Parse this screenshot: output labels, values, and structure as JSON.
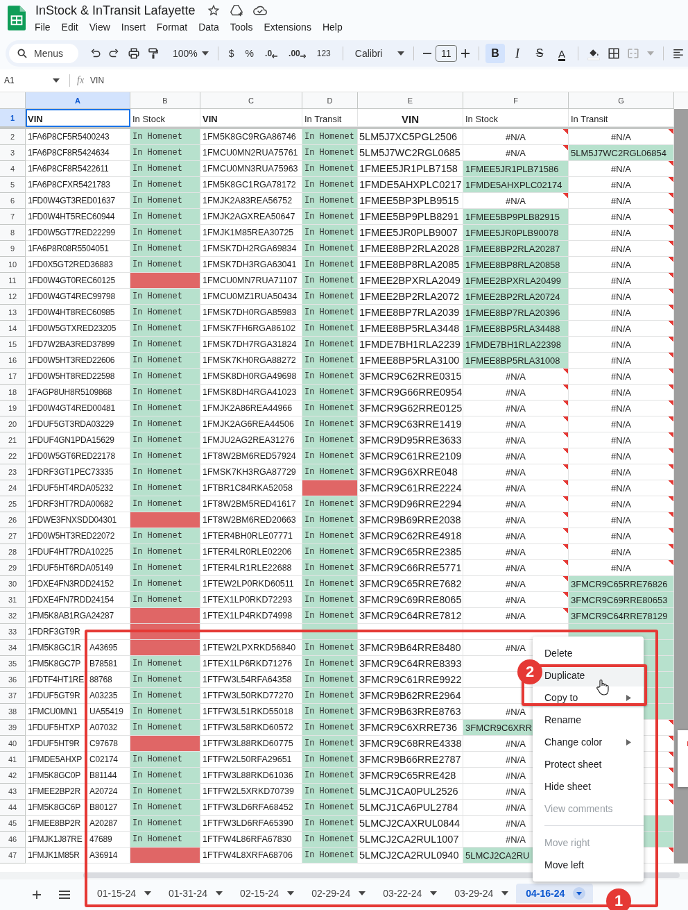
{
  "document": {
    "title": "InStock & InTransit Lafayette"
  },
  "menus": [
    "File",
    "Edit",
    "View",
    "Insert",
    "Format",
    "Data",
    "Tools",
    "Extensions",
    "Help"
  ],
  "toolbar": {
    "search_placeholder": "Menus",
    "zoom": "100%",
    "currency": "$",
    "percent": "%",
    "decrease_decimal": ".0",
    "increase_decimal": ".00",
    "number_format": "123",
    "font": "Calibri",
    "font_size": "11",
    "bold": {
      "label": "B",
      "on": true
    },
    "italic": {
      "label": "I",
      "on": false
    },
    "strikethrough": {
      "label": "S",
      "on": false
    },
    "text_color": {
      "label": "A"
    }
  },
  "formula_bar": {
    "cell": "A1",
    "icon_label": "fx",
    "value": "VIN"
  },
  "columns": [
    {
      "label": "A",
      "selected": true
    },
    {
      "label": "B",
      "selected": false
    },
    {
      "label": "C",
      "selected": false
    },
    {
      "label": "D",
      "selected": false
    },
    {
      "label": "E",
      "selected": false
    },
    {
      "label": "F",
      "selected": false
    },
    {
      "label": "G",
      "selected": false
    }
  ],
  "header_row": {
    "number": "1",
    "selected": true,
    "cells": [
      {
        "text": "VIN",
        "bold": true,
        "centered": false,
        "selected": true
      },
      {
        "text": "In Stock",
        "bold": false,
        "centered": false,
        "selected": false
      },
      {
        "text": "VIN",
        "bold": true,
        "centered": false,
        "selected": false
      },
      {
        "text": "In Transit",
        "bold": false,
        "centered": false,
        "selected": false
      },
      {
        "text": "VIN",
        "bold": true,
        "centered": true,
        "selected": false
      },
      {
        "text": "In Stock",
        "bold": false,
        "centered": false,
        "selected": false
      },
      {
        "text": "In Transit",
        "bold": false,
        "centered": false,
        "selected": false
      }
    ]
  },
  "rows": [
    {
      "number": "2",
      "cells": [
        {
          "text": "1FA6P8CF5R5400243",
          "error": false
        },
        {
          "text": "In Homenet",
          "color": "#b7e1cd",
          "error": false
        },
        {
          "text": "1FM5K8GC9RGA86746",
          "error": false
        },
        {
          "text": "In Homenet",
          "color": "#b7e1cd",
          "error": false
        },
        {
          "text": "5LM5J7XC5PGL2506",
          "error": false
        },
        {
          "text": "#N/A",
          "error": true
        },
        {
          "text": "#N/A",
          "error": true
        }
      ]
    },
    {
      "number": "3",
      "cells": [
        {
          "text": "1FA6P8CF8R5424634",
          "error": false
        },
        {
          "text": "In Homenet",
          "color": "#b7e1cd",
          "error": false
        },
        {
          "text": "1FMCU0MN2RUA75761",
          "error": false
        },
        {
          "text": "In Homenet",
          "color": "#b7e1cd",
          "error": false
        },
        {
          "text": "5LM5J7WC2RGL0685",
          "error": false
        },
        {
          "text": "#N/A",
          "error": true
        },
        {
          "text": "5LM5J7WC2RGL06854",
          "color": "#b7e1cd",
          "error": false
        }
      ]
    },
    {
      "number": "4",
      "cells": [
        {
          "text": "1FA6P8CF8R5422611",
          "error": false
        },
        {
          "text": "In Homenet",
          "color": "#b7e1cd",
          "error": false
        },
        {
          "text": "1FMCU0MN3RUA75963",
          "error": false
        },
        {
          "text": "In Homenet",
          "color": "#b7e1cd",
          "error": false
        },
        {
          "text": "1FMEE5JR1PLB7158",
          "error": false
        },
        {
          "text": "1FMEE5JR1PLB71586",
          "color": "#b7e1cd",
          "error": false
        },
        {
          "text": "#N/A",
          "error": true
        }
      ]
    },
    {
      "number": "5",
      "cells": [
        {
          "text": "1FA6P8CFXR5421783",
          "error": false
        },
        {
          "text": "In Homenet",
          "color": "#b7e1cd",
          "error": false
        },
        {
          "text": "1FM5K8GC1RGA78172",
          "error": false
        },
        {
          "text": "In Homenet",
          "color": "#b7e1cd",
          "error": false
        },
        {
          "text": "1FMDE5AHXPLC0217",
          "error": false
        },
        {
          "text": "1FMDE5AHXPLC02174",
          "color": "#b7e1cd",
          "error": false
        },
        {
          "text": "#N/A",
          "error": true
        }
      ]
    },
    {
      "number": "6",
      "cells": [
        {
          "text": "1FD0W4GT3RED01637",
          "error": false
        },
        {
          "text": "In Homenet",
          "color": "#b7e1cd",
          "error": false
        },
        {
          "text": "1FMJK2A83REA56752",
          "error": false
        },
        {
          "text": "In Homenet",
          "color": "#b7e1cd",
          "error": false
        },
        {
          "text": "1FMEE5BP3PLB9515",
          "error": false
        },
        {
          "text": "#N/A",
          "error": true
        },
        {
          "text": "#N/A",
          "error": true
        }
      ]
    },
    {
      "number": "7",
      "cells": [
        {
          "text": "1FD0W4HT5REC60944",
          "error": false
        },
        {
          "text": "In Homenet",
          "color": "#b7e1cd",
          "error": false
        },
        {
          "text": "1FMJK2AGXREA50647",
          "error": false
        },
        {
          "text": "In Homenet",
          "color": "#b7e1cd",
          "error": false
        },
        {
          "text": "1FMEE5BP9PLB8291",
          "error": false
        },
        {
          "text": "1FMEE5BP9PLB82915",
          "color": "#b7e1cd",
          "error": false
        },
        {
          "text": "#N/A",
          "error": true
        }
      ]
    },
    {
      "number": "8",
      "cells": [
        {
          "text": "1FD0W5GT7RED22299",
          "error": false
        },
        {
          "text": "In Homenet",
          "color": "#b7e1cd",
          "error": false
        },
        {
          "text": "1FMJK1M85REA30725",
          "error": false
        },
        {
          "text": "In Homenet",
          "color": "#b7e1cd",
          "error": false
        },
        {
          "text": "1FMEE5JR0PLB9007",
          "error": false
        },
        {
          "text": "1FMEE5JR0PLB90078",
          "color": "#b7e1cd",
          "error": false
        },
        {
          "text": "#N/A",
          "error": true
        }
      ]
    },
    {
      "number": "9",
      "cells": [
        {
          "text": "1FA6P8R08R5504051",
          "error": false
        },
        {
          "text": "In Homenet",
          "color": "#b7e1cd",
          "error": false
        },
        {
          "text": "1FMSK7DH2RGA69834",
          "error": false
        },
        {
          "text": "In Homenet",
          "color": "#b7e1cd",
          "error": false
        },
        {
          "text": "1FMEE8BP2RLA2028",
          "error": false
        },
        {
          "text": "1FMEE8BP2RLA20287",
          "color": "#b7e1cd",
          "error": false
        },
        {
          "text": "#N/A",
          "error": true
        }
      ]
    },
    {
      "number": "10",
      "cells": [
        {
          "text": "1FD0X5GT2RED36883",
          "error": false
        },
        {
          "text": "In Homenet",
          "color": "#b7e1cd",
          "error": false
        },
        {
          "text": "1FMSK7DH3RGA63041",
          "error": false
        },
        {
          "text": "In Homenet",
          "color": "#b7e1cd",
          "error": false
        },
        {
          "text": "1FMEE8BP8RLA2085",
          "error": false
        },
        {
          "text": "1FMEE8BP8RLA20858",
          "color": "#b7e1cd",
          "error": false
        },
        {
          "text": "#N/A",
          "error": true
        }
      ]
    },
    {
      "number": "11",
      "cells": [
        {
          "text": "1FD0W4GT0REC60125",
          "error": false
        },
        {
          "color": "#e06666",
          "error": false
        },
        {
          "text": "1FMCU0MN7RUA71107",
          "error": false
        },
        {
          "text": "In Homenet",
          "color": "#b7e1cd",
          "error": false
        },
        {
          "text": "1FMEE2BPXRLA2049",
          "error": false
        },
        {
          "text": "1FMEE2BPXRLA20499",
          "color": "#b7e1cd",
          "error": false
        },
        {
          "text": "#N/A",
          "error": true
        }
      ]
    },
    {
      "number": "12",
      "cells": [
        {
          "text": "1FD0W4GT4REC99798",
          "error": false
        },
        {
          "text": "In Homenet",
          "color": "#b7e1cd",
          "error": false
        },
        {
          "text": "1FMCU0MZ1RUA50434",
          "error": false
        },
        {
          "text": "In Homenet",
          "color": "#b7e1cd",
          "error": false
        },
        {
          "text": "1FMEE2BP2RLA2072",
          "error": false
        },
        {
          "text": "1FMEE2BP2RLA20724",
          "color": "#b7e1cd",
          "error": false
        },
        {
          "text": "#N/A",
          "error": true
        }
      ]
    },
    {
      "number": "13",
      "cells": [
        {
          "text": "1FD0W4HT8REC60985",
          "error": false
        },
        {
          "text": "In Homenet",
          "color": "#b7e1cd",
          "error": false
        },
        {
          "text": "1FMSK7DH0RGA85983",
          "error": false
        },
        {
          "text": "In Homenet",
          "color": "#b7e1cd",
          "error": false
        },
        {
          "text": "1FMEE8BP7RLA2039",
          "error": false
        },
        {
          "text": "1FMEE8BP7RLA20396",
          "color": "#b7e1cd",
          "error": false
        },
        {
          "text": "#N/A",
          "error": true
        }
      ]
    },
    {
      "number": "14",
      "cells": [
        {
          "text": "1FD0W5GTXRED23205",
          "error": false
        },
        {
          "text": "In Homenet",
          "color": "#b7e1cd",
          "error": false
        },
        {
          "text": "1FMSK7FH6RGA86102",
          "error": false
        },
        {
          "text": "In Homenet",
          "color": "#b7e1cd",
          "error": false
        },
        {
          "text": "1FMEE8BP5RLA3448",
          "error": false
        },
        {
          "text": "1FMEE8BP5RLA34488",
          "color": "#b7e1cd",
          "error": false
        },
        {
          "text": "#N/A",
          "error": true
        }
      ]
    },
    {
      "number": "15",
      "cells": [
        {
          "text": "1FD7W2BA3RED37899",
          "error": false
        },
        {
          "text": "In Homenet",
          "color": "#b7e1cd",
          "error": false
        },
        {
          "text": "1FMSK7DH7RGA31824",
          "error": false
        },
        {
          "text": "In Homenet",
          "color": "#b7e1cd",
          "error": false
        },
        {
          "text": "1FMDE7BH1RLA2239",
          "error": false
        },
        {
          "text": "1FMDE7BH1RLA22398",
          "color": "#b7e1cd",
          "error": false
        },
        {
          "text": "#N/A",
          "error": true
        }
      ]
    },
    {
      "number": "16",
      "cells": [
        {
          "text": "1FD0W5HT3RED22606",
          "error": false
        },
        {
          "text": "In Homenet",
          "color": "#b7e1cd",
          "error": false
        },
        {
          "text": "1FMSK7KH0RGA88272",
          "error": false
        },
        {
          "text": "In Homenet",
          "color": "#b7e1cd",
          "error": false
        },
        {
          "text": "1FMEE8BP5RLA3100",
          "error": false
        },
        {
          "text": "1FMEE8BP5RLA31008",
          "color": "#b7e1cd",
          "error": false
        },
        {
          "text": "#N/A",
          "error": true
        }
      ]
    },
    {
      "number": "17",
      "cells": [
        {
          "text": "1FD0W5HT8RED22598",
          "error": false
        },
        {
          "text": "In Homenet",
          "color": "#b7e1cd",
          "error": false
        },
        {
          "text": "1FMSK8DH0RGA49698",
          "error": false
        },
        {
          "text": "In Homenet",
          "color": "#b7e1cd",
          "error": false
        },
        {
          "text": "3FMCR9C62RRE0315",
          "error": false
        },
        {
          "text": "#N/A",
          "error": true
        },
        {
          "text": "#N/A",
          "error": true
        }
      ]
    },
    {
      "number": "18",
      "cells": [
        {
          "text": "1FAGP8UH8R5109868",
          "error": false
        },
        {
          "text": "In Homenet",
          "color": "#b7e1cd",
          "error": false
        },
        {
          "text": "1FMSK8DH4RGA41023",
          "error": false
        },
        {
          "text": "In Homenet",
          "color": "#b7e1cd",
          "error": false
        },
        {
          "text": "3FMCR9G66RRE0954",
          "error": false
        },
        {
          "text": "#N/A",
          "error": true
        },
        {
          "text": "#N/A",
          "error": true
        }
      ]
    },
    {
      "number": "19",
      "cells": [
        {
          "text": "1FD0W4GT4RED00481",
          "error": false
        },
        {
          "text": "In Homenet",
          "color": "#b7e1cd",
          "error": false
        },
        {
          "text": "1FMJK2A86REA44966",
          "error": false
        },
        {
          "text": "In Homenet",
          "color": "#b7e1cd",
          "error": false
        },
        {
          "text": "3FMCR9G62RRE0125",
          "error": false
        },
        {
          "text": "#N/A",
          "error": true
        },
        {
          "text": "#N/A",
          "error": true
        }
      ]
    },
    {
      "number": "20",
      "cells": [
        {
          "text": "1FDUF5GT3RDA03229",
          "error": false
        },
        {
          "text": "In Homenet",
          "color": "#b7e1cd",
          "error": false
        },
        {
          "text": "1FMJK2AG6REA44506",
          "error": false
        },
        {
          "text": "In Homenet",
          "color": "#b7e1cd",
          "error": false
        },
        {
          "text": "3FMCR9C63RRE1419",
          "error": false
        },
        {
          "text": "#N/A",
          "error": true
        },
        {
          "text": "#N/A",
          "error": true
        }
      ]
    },
    {
      "number": "21",
      "cells": [
        {
          "text": "1FDUF4GN1PDA15629",
          "error": false
        },
        {
          "text": "In Homenet",
          "color": "#b7e1cd",
          "error": false
        },
        {
          "text": "1FMJU2AG2REA31276",
          "error": false
        },
        {
          "text": "In Homenet",
          "color": "#b7e1cd",
          "error": false
        },
        {
          "text": "3FMCR9D95RRE3633",
          "error": false
        },
        {
          "text": "#N/A",
          "error": true
        },
        {
          "text": "#N/A",
          "error": true
        }
      ]
    },
    {
      "number": "22",
      "cells": [
        {
          "text": "1FD0W5GT6RED22178",
          "error": false
        },
        {
          "text": "In Homenet",
          "color": "#b7e1cd",
          "error": false
        },
        {
          "text": "1FT8W2BM6RED57924",
          "error": false
        },
        {
          "text": "In Homenet",
          "color": "#b7e1cd",
          "error": false
        },
        {
          "text": "3FMCR9C61RRE2109",
          "error": false
        },
        {
          "text": "#N/A",
          "error": true
        },
        {
          "text": "#N/A",
          "error": true
        }
      ]
    },
    {
      "number": "23",
      "cells": [
        {
          "text": "1FDRF3GT1PEC73335",
          "error": false
        },
        {
          "text": "In Homenet",
          "color": "#b7e1cd",
          "error": false
        },
        {
          "text": "1FMSK7KH3RGA87729",
          "error": false
        },
        {
          "text": "In Homenet",
          "color": "#b7e1cd",
          "error": false
        },
        {
          "text": "3FMCR9G6XRRE048",
          "error": false
        },
        {
          "text": "#N/A",
          "error": true
        },
        {
          "text": "#N/A",
          "error": true
        }
      ]
    },
    {
      "number": "24",
      "cells": [
        {
          "text": "1FDUF5HT4RDA05232",
          "error": false
        },
        {
          "text": "In Homenet",
          "color": "#b7e1cd",
          "error": false
        },
        {
          "text": "1FTBR1C84RKA52058",
          "error": false
        },
        {
          "color": "#e06666",
          "error": false
        },
        {
          "text": "3FMCR9C61RRE2224",
          "error": false
        },
        {
          "text": "#N/A",
          "error": true
        },
        {
          "text": "#N/A",
          "error": true
        }
      ]
    },
    {
      "number": "25",
      "cells": [
        {
          "text": "1FDRF3HT7RDA00682",
          "error": false
        },
        {
          "text": "In Homenet",
          "color": "#b7e1cd",
          "error": false
        },
        {
          "text": "1FT8W2BM5RED41617",
          "error": false
        },
        {
          "text": "In Homenet",
          "color": "#b7e1cd",
          "error": false
        },
        {
          "text": "3FMCR9D96RRE2294",
          "error": false
        },
        {
          "text": "#N/A",
          "error": true
        },
        {
          "text": "#N/A",
          "error": true
        }
      ]
    },
    {
      "number": "26",
      "cells": [
        {
          "text": "1FDWE3FNXSDD04301",
          "error": false
        },
        {
          "color": "#e06666",
          "error": false
        },
        {
          "text": "1FT8W2BM6RED20663",
          "error": false
        },
        {
          "text": "In Homenet",
          "color": "#b7e1cd",
          "error": false
        },
        {
          "text": "3FMCR9B69RRE2038",
          "error": false
        },
        {
          "text": "#N/A",
          "error": true
        },
        {
          "text": "#N/A",
          "error": true
        }
      ]
    },
    {
      "number": "27",
      "cells": [
        {
          "text": "1FD0W5HT3RED22072",
          "error": false
        },
        {
          "text": "In Homenet",
          "color": "#b7e1cd",
          "error": false
        },
        {
          "text": "1FTER4BH0RLE07771",
          "error": false
        },
        {
          "text": "In Homenet",
          "color": "#b7e1cd",
          "error": false
        },
        {
          "text": "3FMCR9C62RRE4918",
          "error": false
        },
        {
          "text": "#N/A",
          "error": true
        },
        {
          "text": "#N/A",
          "error": true
        }
      ]
    },
    {
      "number": "28",
      "cells": [
        {
          "text": "1FDUF4HT7RDA10225",
          "error": false
        },
        {
          "text": "In Homenet",
          "color": "#b7e1cd",
          "error": false
        },
        {
          "text": "1FTER4LR0RLE02206",
          "error": false
        },
        {
          "text": "In Homenet",
          "color": "#b7e1cd",
          "error": false
        },
        {
          "text": "3FMCR9C65RRE2385",
          "error": false
        },
        {
          "text": "#N/A",
          "error": true
        },
        {
          "text": "#N/A",
          "error": true
        }
      ]
    },
    {
      "number": "29",
      "cells": [
        {
          "text": "1FDUF5HT6RDA05149",
          "error": false
        },
        {
          "text": "In Homenet",
          "color": "#b7e1cd",
          "error": false
        },
        {
          "text": "1FTER4LR1RLE22688",
          "error": false
        },
        {
          "text": "In Homenet",
          "color": "#b7e1cd",
          "error": false
        },
        {
          "text": "3FMCR9C66RRE5771",
          "error": false
        },
        {
          "text": "#N/A",
          "error": true
        },
        {
          "text": "#N/A",
          "error": true
        }
      ]
    },
    {
      "number": "30",
      "cells": [
        {
          "text": "1FDXE4FN3RDD24152",
          "error": false
        },
        {
          "text": "In Homenet",
          "color": "#b7e1cd",
          "error": false
        },
        {
          "text": "1FTEW2LP0RKD60511",
          "error": false
        },
        {
          "text": "In Homenet",
          "color": "#b7e1cd",
          "error": false
        },
        {
          "text": "3FMCR9C65RRE7682",
          "error": false
        },
        {
          "text": "#N/A",
          "error": true
        },
        {
          "text": "3FMCR9C65RRE76826",
          "color": "#b7e1cd",
          "error": false
        }
      ]
    },
    {
      "number": "31",
      "cells": [
        {
          "text": "1FDXE4FN7RDD24154",
          "error": false
        },
        {
          "text": "In Homenet",
          "color": "#b7e1cd",
          "error": false
        },
        {
          "text": "1FTEX1LP0RKD72293",
          "error": false
        },
        {
          "text": "In Homenet",
          "color": "#b7e1cd",
          "error": false
        },
        {
          "text": "3FMCR9C69RRE8065",
          "error": false
        },
        {
          "text": "#N/A",
          "error": true
        },
        {
          "text": "3FMCR9C69RRE80653",
          "color": "#b7e1cd",
          "error": false
        }
      ]
    },
    {
      "number": "32",
      "cells": [
        {
          "text": "1FM5K8AB1RGA24287",
          "error": false
        },
        {
          "color": "#e06666",
          "error": false
        },
        {
          "text": "1FTEX1LP4RKD74998",
          "error": false
        },
        {
          "text": "In Homenet",
          "color": "#b7e1cd",
          "error": false
        },
        {
          "text": "3FMCR9C64RRE7812",
          "error": false
        },
        {
          "text": "#N/A",
          "error": true
        },
        {
          "text": "3FMCR9C64RRE78129",
          "color": "#b7e1cd",
          "error": false
        }
      ]
    },
    {
      "number": "33",
      "cells": [
        {
          "text": "1FDRF3GT9R",
          "error": false
        },
        {
          "color": "#e06666",
          "error": false
        },
        {
          "error": false
        },
        {
          "color": "#b7e1cd",
          "error": false
        },
        {
          "error": false
        },
        {
          "error": false
        },
        {
          "color": "#b7e1cd",
          "error": false
        }
      ]
    },
    {
      "number": "34",
      "cells": [
        {
          "text": "1FM5K8GC1R",
          "text_after": "A43695"
        },
        {
          "color": "#e06666",
          "error": false
        },
        {
          "text": "1FTEW2LPXRKD56840",
          "error": false
        },
        {
          "text": "In Homenet",
          "color": "#b7e1cd",
          "error": false
        },
        {
          "text": "3FMCR9B64RRE8480",
          "error": false
        },
        {
          "text": "#N/A",
          "error": true
        },
        {
          "color": "#b7e1cd",
          "error": false
        }
      ]
    },
    {
      "number": "35",
      "cells": [
        {
          "text": "1FM5K8GC7P",
          "text_after": "B78581"
        },
        {
          "text": "In Homenet",
          "color": "#b7e1cd",
          "error": false
        },
        {
          "text": "1FTEX1LP6RKD71276",
          "error": false
        },
        {
          "text": "In Homenet",
          "color": "#b7e1cd",
          "error": false
        },
        {
          "text": "3FMCR9C64RRE8393",
          "error": false
        },
        {},
        {
          "color": "#b7e1cd",
          "error": false
        }
      ]
    },
    {
      "number": "36",
      "cells": [
        {
          "text": "1FDTF4HT1RE",
          "text_after": "88768"
        },
        {
          "text": "In Homenet",
          "color": "#b7e1cd",
          "error": false
        },
        {
          "text": "1FTFW3L54RFA64358",
          "error": false
        },
        {
          "text": "In Homenet",
          "color": "#b7e1cd",
          "error": false
        },
        {
          "text": "3FMCR9C61RRE9922",
          "error": false
        },
        {},
        {
          "color": "#b7e1cd",
          "error": false
        }
      ]
    },
    {
      "number": "37",
      "cells": [
        {
          "text": "1FDUF5GT9R",
          "text_after": "A03235"
        },
        {
          "text": "In Homenet",
          "color": "#b7e1cd",
          "error": false
        },
        {
          "text": "1FTFW3L50RKD77270",
          "error": false
        },
        {
          "text": "In Homenet",
          "color": "#b7e1cd",
          "error": false
        },
        {
          "text": "3FMCR9B62RRE2964",
          "error": false
        },
        {},
        {
          "color": "#b7e1cd",
          "error": false
        }
      ]
    },
    {
      "number": "38",
      "cells": [
        {
          "text": "1FMCU0MN1",
          "text_after": "UA55419"
        },
        {
          "text": "In Homenet",
          "color": "#b7e1cd",
          "error": false
        },
        {
          "text": "1FTFW3L51RKD55018",
          "error": false
        },
        {
          "text": "In Homenet",
          "color": "#b7e1cd",
          "error": false
        },
        {
          "text": "3FMCR9B63RRE8763",
          "error": false
        },
        {
          "text": "#N/A",
          "error": true
        },
        {
          "color": "#b7e1cd",
          "error": false
        }
      ]
    },
    {
      "number": "39",
      "cells": [
        {
          "text": "1FDUF5HTXP",
          "text_after": "A07032"
        },
        {
          "text": "In Homenet",
          "color": "#b7e1cd",
          "error": false
        },
        {
          "text": "1FTFW3L58RKD60572",
          "error": false
        },
        {
          "text": "In Homenet",
          "color": "#b7e1cd",
          "error": false
        },
        {
          "text": "3FMCR9C6XRRE736",
          "error": false
        },
        {
          "text": "3FMCR9C6XRR",
          "color": "#b7e1cd",
          "error": false
        },
        {
          "error": true
        }
      ]
    },
    {
      "number": "40",
      "cells": [
        {
          "text": "1FDUF5HT9R",
          "text_after": "C97678"
        },
        {
          "color": "#e06666",
          "error": false
        },
        {
          "text": "1FTFW3L88RKD60775",
          "error": false
        },
        {
          "text": "In Homenet",
          "color": "#b7e1cd",
          "error": false
        },
        {
          "text": "3FMCR9C68RRE4338",
          "error": false
        },
        {
          "text": "#N/A",
          "error": true
        },
        {
          "error": true
        }
      ]
    },
    {
      "number": "41",
      "cells": [
        {
          "text": "1FMDE5AHXP",
          "text_after": "C02174"
        },
        {
          "text": "In Homenet",
          "color": "#b7e1cd",
          "error": false
        },
        {
          "text": "1FTFW2L50RFA29651",
          "error": false
        },
        {
          "text": "In Homenet",
          "color": "#b7e1cd",
          "error": false
        },
        {
          "text": "3FMCR9B66RRE2787",
          "error": false
        },
        {
          "text": "#N/A",
          "error": true
        },
        {
          "error": true
        }
      ]
    },
    {
      "number": "42",
      "cells": [
        {
          "text": "1FM5K8GC0P",
          "text_after": "B81144"
        },
        {
          "text": "In Homenet",
          "color": "#b7e1cd",
          "error": false
        },
        {
          "text": "1FTFW3L88RKD61036",
          "error": false
        },
        {
          "text": "In Homenet",
          "color": "#b7e1cd",
          "error": false
        },
        {
          "text": "3FMCR9C65RRE428",
          "error": false
        },
        {
          "text": "#N/A",
          "error": true
        },
        {
          "error": true
        }
      ]
    },
    {
      "number": "43",
      "cells": [
        {
          "text": "1FMEE2BP2R",
          "text_after": "A20724"
        },
        {
          "text": "In Homenet",
          "color": "#b7e1cd",
          "error": false
        },
        {
          "text": "1FTFW2L5XRKD70739",
          "error": false
        },
        {
          "text": "In Homenet",
          "color": "#b7e1cd",
          "error": false
        },
        {
          "text": "5LMCJ1CA0PUL2526",
          "error": false
        },
        {
          "text": "#N/A",
          "error": true
        },
        {
          "error": true
        }
      ]
    },
    {
      "number": "44",
      "cells": [
        {
          "text": "1FM5K8GC6P",
          "text_after": "B80127"
        },
        {
          "text": "In Homenet",
          "color": "#b7e1cd",
          "error": false
        },
        {
          "text": "1FTFW3LD6RFA68452",
          "error": false
        },
        {
          "text": "In Homenet",
          "color": "#b7e1cd",
          "error": false
        },
        {
          "text": "5LMCJ1CA6PUL2784",
          "error": false
        },
        {
          "text": "#N/A",
          "error": true
        },
        {
          "error": true
        }
      ]
    },
    {
      "number": "45",
      "cells": [
        {
          "text": "1FMEE8BP2R",
          "text_after": "A20287"
        },
        {
          "text": "In Homenet",
          "color": "#b7e1cd",
          "error": false
        },
        {
          "text": "1FTFW3LD6RFA65390",
          "error": false
        },
        {
          "text": "In Homenet",
          "color": "#b7e1cd",
          "error": false
        },
        {
          "text": "5LMCJ2CAXRUL0844",
          "error": false
        },
        {
          "text": "#N/A",
          "error": true
        },
        {
          "color": "#b7e1cd",
          "error": false
        }
      ]
    },
    {
      "number": "46",
      "cells": [
        {
          "text": "1FMJK1J87RE",
          "text_after": "47689"
        },
        {
          "text": "In Homenet",
          "color": "#b7e1cd",
          "error": false
        },
        {
          "text": "1FTFW4L86RFA67830",
          "error": false
        },
        {
          "text": "In Homenet",
          "color": "#b7e1cd",
          "error": false
        },
        {
          "text": "5LMCJ2CA2RUL1007",
          "error": false
        },
        {
          "text": "#N/A",
          "error": true
        },
        {
          "color": "#b7e1cd",
          "error": false
        }
      ]
    },
    {
      "number": "47",
      "cells": [
        {
          "text": "1FMJK1M85R",
          "text_after": "A36914"
        },
        {
          "color": "#e06666",
          "error": false
        },
        {
          "text": "1FTFW4L8XRFA68706",
          "error": false
        },
        {
          "text": "In Homenet",
          "color": "#b7e1cd",
          "error": false
        },
        {
          "text": "5LMCJ2CA2RUL0940",
          "error": false
        },
        {
          "text": "5LMCJ2CA2RU",
          "color": "#b7e1cd",
          "error": false
        },
        {
          "error": true
        }
      ]
    }
  ],
  "sheet_tabs": [
    {
      "label": "01-15-24",
      "selected": false
    },
    {
      "label": "01-31-24",
      "selected": false
    },
    {
      "label": "02-15-24",
      "selected": false
    },
    {
      "label": "02-29-24",
      "selected": false
    },
    {
      "label": "03-22-24",
      "selected": false
    },
    {
      "label": "03-29-24",
      "selected": false
    },
    {
      "label": "04-16-24",
      "selected": true
    }
  ],
  "context_menu": {
    "sections": [
      {
        "items": [
          {
            "label": "Delete",
            "disabled": false,
            "selected": false,
            "submenu": false
          },
          {
            "label": "Duplicate",
            "disabled": false,
            "selected": true,
            "submenu": false
          },
          {
            "label": "Copy to",
            "disabled": false,
            "selected": false,
            "submenu": true
          },
          {
            "label": "Rename",
            "disabled": false,
            "selected": false,
            "submenu": false
          },
          {
            "label": "Change color",
            "disabled": false,
            "selected": false,
            "submenu": true
          },
          {
            "label": "Protect sheet",
            "disabled": false,
            "selected": false,
            "submenu": false
          },
          {
            "label": "Hide sheet",
            "disabled": false,
            "selected": false,
            "submenu": false
          },
          {
            "label": "View comments",
            "disabled": true,
            "selected": false,
            "submenu": false
          }
        ]
      },
      {
        "items": [
          {
            "label": "Move right",
            "disabled": true,
            "selected": false,
            "submenu": false
          },
          {
            "label": "Move left",
            "disabled": false,
            "selected": false,
            "submenu": false
          }
        ]
      }
    ]
  },
  "annotations": [
    {
      "label": "1"
    },
    {
      "label": "2"
    }
  ]
}
